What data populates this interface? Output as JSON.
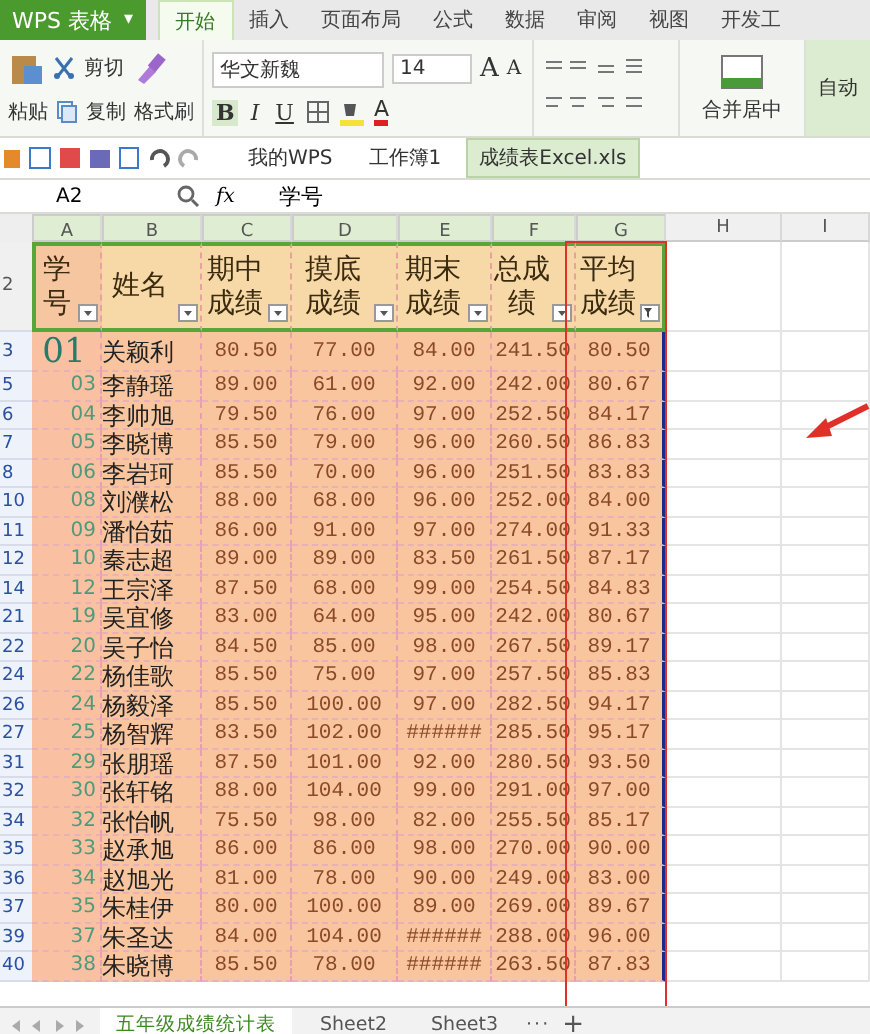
{
  "app": {
    "name": "WPS 表格",
    "menu_caret": "▾"
  },
  "ribbon_tabs": [
    {
      "label": "开始",
      "selected": true
    },
    {
      "label": "插入",
      "selected": false
    },
    {
      "label": "页面布局",
      "selected": false
    },
    {
      "label": "公式",
      "selected": false
    },
    {
      "label": "数据",
      "selected": false
    },
    {
      "label": "审阅",
      "selected": false
    },
    {
      "label": "视图",
      "selected": false
    },
    {
      "label": "开发工",
      "selected": false
    }
  ],
  "clipboard": {
    "paste": "粘贴",
    "cut": "剪切",
    "copy": "复制",
    "painter": "格式刷"
  },
  "font": {
    "family": "华文新魏",
    "size": "14",
    "grow": "A",
    "shrink": "A",
    "bold": "B",
    "italic": "I",
    "underline": "U",
    "color_letter": "A"
  },
  "merge": {
    "label": "合并居中",
    "auto": "自动"
  },
  "doc_tabs": [
    {
      "label": "我的WPS",
      "selected": false
    },
    {
      "label": "工作簿1",
      "selected": false
    },
    {
      "label": "成绩表Excel.xls",
      "selected": true
    }
  ],
  "formula_bar": {
    "cell_ref": "A2",
    "fx": "fx",
    "value": "学号"
  },
  "columns": [
    "A",
    "B",
    "C",
    "D",
    "E",
    "F",
    "G",
    "H",
    "I"
  ],
  "header_row": {
    "row": "2",
    "cells": [
      {
        "label": "学号",
        "filtered": false
      },
      {
        "label": "姓名",
        "filtered": false
      },
      {
        "label": "期中成绩",
        "filtered": false
      },
      {
        "label": "摸底成绩",
        "filtered": false
      },
      {
        "label": "期末成绩",
        "filtered": false
      },
      {
        "label": "总成绩",
        "filtered": false
      },
      {
        "label": "平均成绩",
        "filtered": true
      }
    ]
  },
  "rows": [
    {
      "row": "3",
      "big_id": true,
      "cells": [
        "01",
        "关颖利",
        "80.50",
        "77.00",
        "84.00",
        "241.50",
        "80.50"
      ]
    },
    {
      "row": "5",
      "big_id": false,
      "cells": [
        "03",
        "李静瑶",
        "89.00",
        "61.00",
        "92.00",
        "242.00",
        "80.67"
      ]
    },
    {
      "row": "6",
      "big_id": false,
      "cells": [
        "04",
        "李帅旭",
        "79.50",
        "76.00",
        "97.00",
        "252.50",
        "84.17"
      ]
    },
    {
      "row": "7",
      "big_id": false,
      "cells": [
        "05",
        "李晓博",
        "85.50",
        "79.00",
        "96.00",
        "260.50",
        "86.83"
      ]
    },
    {
      "row": "8",
      "big_id": false,
      "cells": [
        "06",
        "李岩珂",
        "85.50",
        "70.00",
        "96.00",
        "251.50",
        "83.83"
      ]
    },
    {
      "row": "10",
      "big_id": false,
      "cells": [
        "08",
        "刘濮松",
        "88.00",
        "68.00",
        "96.00",
        "252.00",
        "84.00"
      ]
    },
    {
      "row": "11",
      "big_id": false,
      "cells": [
        "09",
        "潘怡茹",
        "86.00",
        "91.00",
        "97.00",
        "274.00",
        "91.33"
      ]
    },
    {
      "row": "12",
      "big_id": false,
      "cells": [
        "10",
        "秦志超",
        "89.00",
        "89.00",
        "83.50",
        "261.50",
        "87.17"
      ]
    },
    {
      "row": "14",
      "big_id": false,
      "cells": [
        "12",
        "王宗泽",
        "87.50",
        "68.00",
        "99.00",
        "254.50",
        "84.83"
      ]
    },
    {
      "row": "21",
      "big_id": false,
      "cells": [
        "19",
        "吴宜修",
        "83.00",
        "64.00",
        "95.00",
        "242.00",
        "80.67"
      ]
    },
    {
      "row": "22",
      "big_id": false,
      "cells": [
        "20",
        "吴子怡",
        "84.50",
        "85.00",
        "98.00",
        "267.50",
        "89.17"
      ]
    },
    {
      "row": "24",
      "big_id": false,
      "cells": [
        "22",
        "杨佳歌",
        "85.50",
        "75.00",
        "97.00",
        "257.50",
        "85.83"
      ]
    },
    {
      "row": "26",
      "big_id": false,
      "cells": [
        "24",
        "杨毅泽",
        "85.50",
        "100.00",
        "97.00",
        "282.50",
        "94.17"
      ]
    },
    {
      "row": "27",
      "big_id": false,
      "cells": [
        "25",
        "杨智辉",
        "83.50",
        "102.00",
        "######",
        "285.50",
        "95.17"
      ]
    },
    {
      "row": "31",
      "big_id": false,
      "cells": [
        "29",
        "张朋瑶",
        "87.50",
        "101.00",
        "92.00",
        "280.50",
        "93.50"
      ]
    },
    {
      "row": "32",
      "big_id": false,
      "cells": [
        "30",
        "张轩铭",
        "88.00",
        "104.00",
        "99.00",
        "291.00",
        "97.00"
      ]
    },
    {
      "row": "34",
      "big_id": false,
      "cells": [
        "32",
        "张怡帆",
        "75.50",
        "98.00",
        "82.00",
        "255.50",
        "85.17"
      ]
    },
    {
      "row": "35",
      "big_id": false,
      "cells": [
        "33",
        "赵承旭",
        "86.00",
        "86.00",
        "98.00",
        "270.00",
        "90.00"
      ]
    },
    {
      "row": "36",
      "big_id": false,
      "cells": [
        "34",
        "赵旭光",
        "81.00",
        "78.00",
        "90.00",
        "249.00",
        "83.00"
      ]
    },
    {
      "row": "37",
      "big_id": false,
      "cells": [
        "35",
        "朱桂伊",
        "80.00",
        "100.00",
        "89.00",
        "269.00",
        "89.67"
      ]
    },
    {
      "row": "39",
      "big_id": false,
      "cells": [
        "37",
        "朱圣达",
        "84.00",
        "104.00",
        "######",
        "288.00",
        "96.00"
      ]
    },
    {
      "row": "40",
      "big_id": false,
      "cells": [
        "38",
        "朱晓博",
        "85.50",
        "78.00",
        "######",
        "263.50",
        "87.83"
      ]
    }
  ],
  "sheet_tabs": [
    {
      "label": "五年级成绩统计表",
      "selected": true
    },
    {
      "label": "Sheet2",
      "selected": false
    },
    {
      "label": "Sheet3",
      "selected": false
    }
  ],
  "sheet_more": "···",
  "sheet_add": "+"
}
